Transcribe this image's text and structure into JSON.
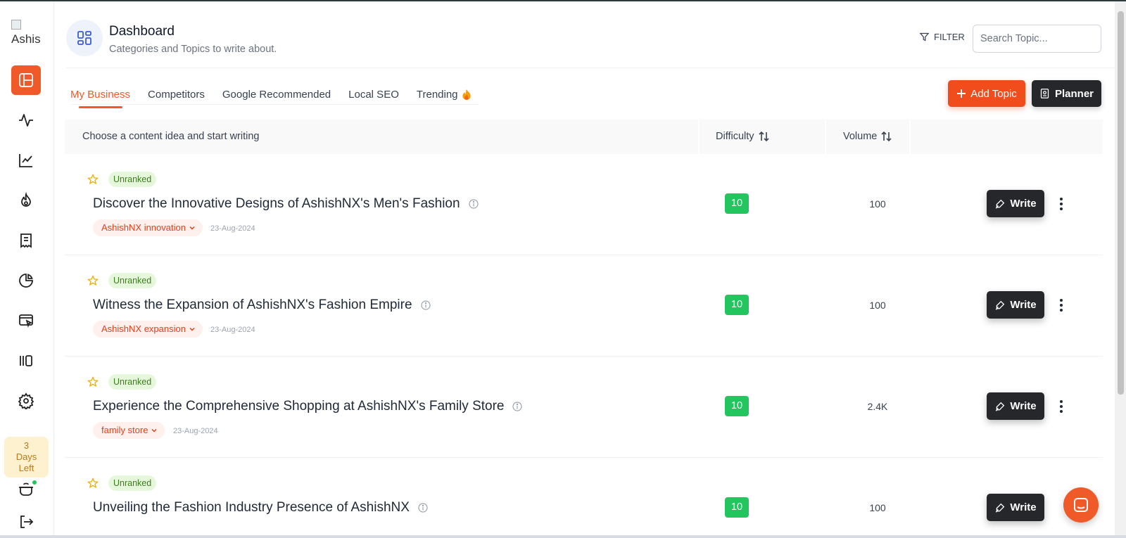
{
  "sidebar": {
    "logo_alt": "Ashis",
    "trial": {
      "line1": "3",
      "line2": "Days",
      "line3": "Left"
    }
  },
  "header": {
    "title": "Dashboard",
    "subtitle": "Categories and Topics to write about.",
    "filter_label": "FILTER",
    "search_placeholder": "Search Topic..."
  },
  "tabs": [
    {
      "label": "My Business",
      "active": true
    },
    {
      "label": "Competitors"
    },
    {
      "label": "Google Recommended"
    },
    {
      "label": "Local SEO"
    },
    {
      "label": "Trending"
    }
  ],
  "actions": {
    "add_topic": "Add Topic",
    "planner": "Planner"
  },
  "table": {
    "col_topic": "Choose a content idea and start writing",
    "col_difficulty": "Difficulty",
    "col_volume": "Volume"
  },
  "rows": [
    {
      "status": "Unranked",
      "title": "Discover the Innovative Designs of AshishNX's Men's Fashion",
      "tag": "AshishNX innovation",
      "date": "23-Aug-2024",
      "difficulty": "10",
      "volume": "100",
      "write": "Write"
    },
    {
      "status": "Unranked",
      "title": "Witness the Expansion of AshishNX's Fashion Empire",
      "tag": "AshishNX expansion",
      "date": "23-Aug-2024",
      "difficulty": "10",
      "volume": "100",
      "write": "Write"
    },
    {
      "status": "Unranked",
      "title": "Experience the Comprehensive Shopping at AshishNX's Family Store",
      "tag": "family store",
      "date": "23-Aug-2024",
      "difficulty": "10",
      "volume": "2.4K",
      "write": "Write"
    },
    {
      "status": "Unranked",
      "title": "Unveiling the Fashion Industry Presence of AshishNX",
      "difficulty": "10",
      "volume": "100",
      "write": "Write"
    }
  ],
  "colors": {
    "accent": "#f05a28",
    "dark": "#25272b",
    "success": "#22c55e"
  }
}
